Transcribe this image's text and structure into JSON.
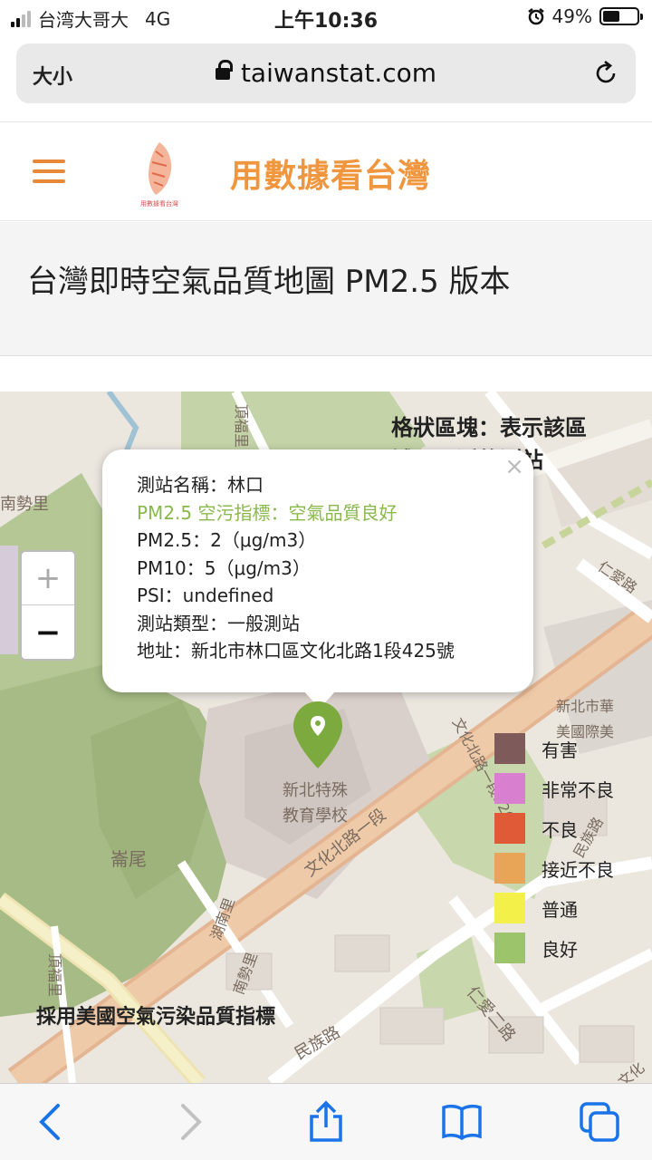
{
  "status_bar": {
    "carrier": "台湾大哥大",
    "network": "4G",
    "time": "上午10:36",
    "battery_percent": "49%",
    "battery_level": 0.49
  },
  "browser": {
    "text_size_label": "大小",
    "url": "taiwanstat.com"
  },
  "site": {
    "logo_text": "用數據看台灣",
    "title": "用數據看台灣"
  },
  "page": {
    "title": "台灣即時空氣品質地圖 PM2.5 版本"
  },
  "map": {
    "grid_note_line1": "格狀區塊：表示該區",
    "grid_note_line2": "域內最近的測站",
    "zoom_in": "+",
    "zoom_out": "−",
    "labels": {
      "a": "南勢里",
      "b": "頂福里",
      "c": "崙尾",
      "d": "湖南里",
      "e": "南勢里",
      "f": "頂福里",
      "g": "文化北路一段",
      "h": "文化北路一段526巷",
      "i": "民族路",
      "j": "仁愛二路",
      "k": "仁愛路",
      "l": "新北特殊",
      "m": "教育學校",
      "n": "新北市華",
      "o": "美國際美",
      "p": "民族路",
      "q": "文化"
    },
    "popup": {
      "close": "×",
      "station": "測站名稱：林口",
      "status": "PM2.5 空污指標：空氣品質良好",
      "pm25": "PM2.5：2（μg/m3）",
      "pm10": "PM10：5（μg/m3）",
      "psi": "PSI：undefined",
      "type": "測站類型：一般測站",
      "address": "地址：新北市林口區文化北路1段425號"
    },
    "legend": [
      {
        "label": "有害",
        "color": "#7e5a5a"
      },
      {
        "label": "非常不良",
        "color": "#d97fcf"
      },
      {
        "label": "不良",
        "color": "#e05a38"
      },
      {
        "label": "接近不良",
        "color": "#e8a457"
      },
      {
        "label": "普通",
        "color": "#f4f04a"
      },
      {
        "label": "良好",
        "color": "#9cc46a"
      }
    ],
    "aqi_note": "採用美國空氣污染品質指標"
  },
  "toolbar": {
    "back": "back-icon",
    "forward": "forward-icon",
    "share": "share-icon",
    "bookmarks": "book-icon",
    "tabs": "tabs-icon"
  },
  "colors": {
    "accent": "#f0963e",
    "good": "#8ab84d",
    "ios_blue": "#1a73e8"
  }
}
